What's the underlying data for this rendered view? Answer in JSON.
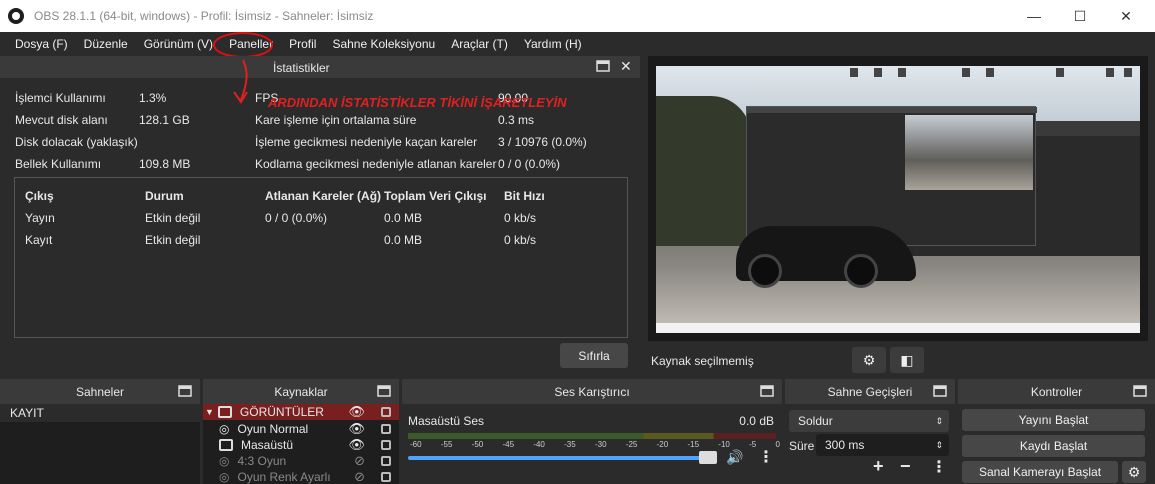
{
  "window": {
    "title": "OBS 28.1.1 (64-bit, windows) - Profil: İsimsiz - Sahneler: İsimsiz",
    "minimize": "—",
    "maximize": "☐",
    "close": "✕"
  },
  "menu": [
    "Dosya (F)",
    "Düzenle",
    "Görünüm (V)",
    "Paneller",
    "Profil",
    "Sahne Koleksiyonu",
    "Araçlar (T)",
    "Yardım (H)"
  ],
  "annotation": "ARDINDAN İSTATİSTİKLER TİKİNİ İŞARETLEYİN",
  "stats": {
    "title": "İstatistikler",
    "left": [
      {
        "label": "İşlemci Kullanımı",
        "value": "1.3%"
      },
      {
        "label": "Mevcut disk alanı",
        "value": "128.1 GB"
      },
      {
        "label": "Disk dolacak (yaklaşık)",
        "value": ""
      },
      {
        "label": "Bellek Kullanımı",
        "value": "109.8 MB"
      }
    ],
    "right": [
      {
        "label": "FPS",
        "value": "90.00"
      },
      {
        "label": "Kare işleme için ortalama süre",
        "value": "0.3 ms"
      },
      {
        "label": "İşleme gecikmesi nedeniyle kaçan kareler",
        "value": "3 / 10976 (0.0%)"
      },
      {
        "label": "Kodlama gecikmesi nedeniyle atlanan kareler",
        "value": "0 / 0 (0.0%)"
      }
    ],
    "table": {
      "headers": [
        "Çıkış",
        "Durum",
        "Atlanan Kareler (Ağ)",
        "Toplam Veri Çıkışı",
        "Bit Hızı"
      ],
      "rows": [
        [
          "Yayın",
          "Etkin değil",
          "0 / 0 (0.0%)",
          "0.0 MB",
          "0 kb/s"
        ],
        [
          "Kayıt",
          "Etkin değil",
          "",
          "0.0 MB",
          "0 kb/s"
        ]
      ]
    },
    "reset": "Sıfırla"
  },
  "source_bar": {
    "label": "Kaynak seçilmemiş"
  },
  "docks": {
    "scenes": {
      "title": "Sahneler",
      "items": [
        "KAYIT"
      ]
    },
    "sources": {
      "title": "Kaynaklar",
      "items": [
        "GÖRÜNTÜLER",
        "Oyun Normal",
        "Masaüstü",
        "4:3 Oyun",
        "Oyun Renk Ayarlı"
      ]
    },
    "mixer": {
      "title": "Ses Karıştırıcı",
      "track": "Masaüstü Ses",
      "level": "0.0 dB",
      "ticks": [
        "-60",
        "-55",
        "-50",
        "-45",
        "-40",
        "-35",
        "-30",
        "-25",
        "-20",
        "-15",
        "-10",
        "-5",
        "0"
      ],
      "volume_fraction": 0.98
    },
    "transitions": {
      "title": "Sahne Geçişleri",
      "selected": "Soldur",
      "duration_label": "Süre",
      "duration": "300 ms"
    },
    "controls": {
      "title": "Kontroller",
      "buttons": [
        "Yayını Başlat",
        "Kaydı Başlat",
        "Sanal Kamerayı Başlat"
      ]
    }
  }
}
